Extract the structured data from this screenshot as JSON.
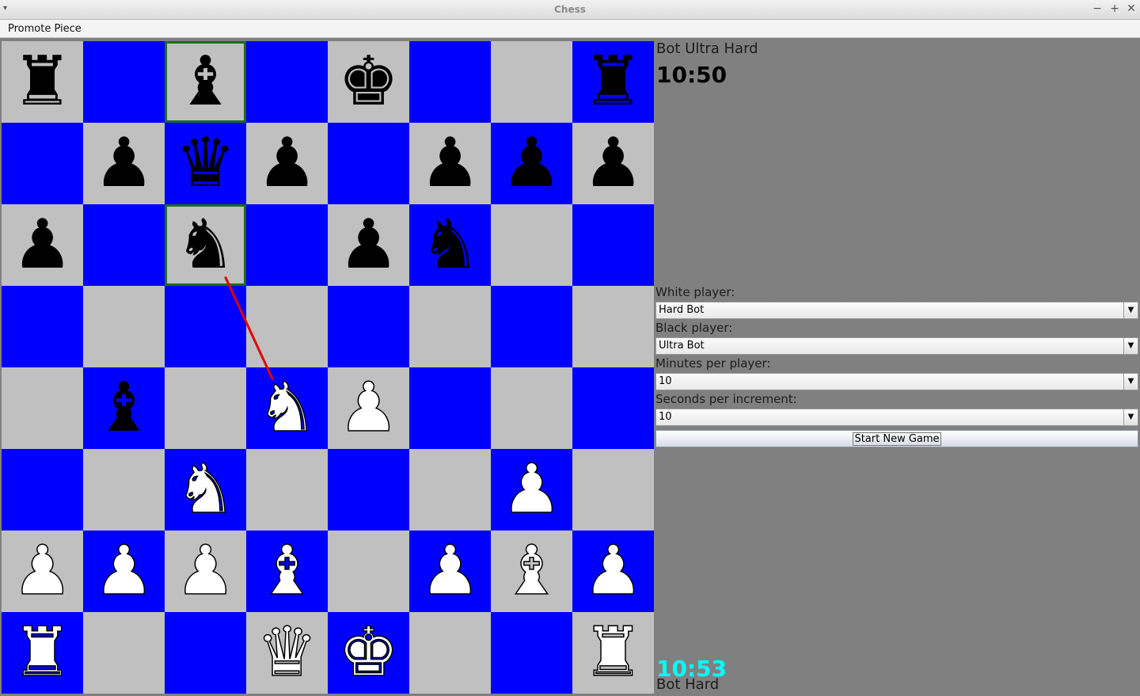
{
  "window": {
    "title": "Chess"
  },
  "menubar": {
    "items": [
      "Promote Piece"
    ]
  },
  "colors": {
    "light_square": "#c0c0c0",
    "dark_square": "#0000ff",
    "highlight": "#1f6b1f",
    "last_move_arrow": "#e00000",
    "white_clock": "#00ffff",
    "panel_bg": "#808080"
  },
  "board": {
    "ranks": [
      [
        "br",
        "",
        "bb",
        "",
        "bk",
        "",
        "",
        "br"
      ],
      [
        "",
        "bp",
        "bq",
        "bp",
        "",
        "bp",
        "bp",
        "bp"
      ],
      [
        "bp",
        "",
        "bn",
        "",
        "bp",
        "bn",
        "",
        ""
      ],
      [
        "",
        "",
        "",
        "",
        "",
        "",
        "",
        ""
      ],
      [
        "",
        "bb",
        "",
        "wn",
        "wp",
        "",
        "",
        ""
      ],
      [
        "",
        "",
        "wn",
        "",
        "",
        "",
        "wp",
        ""
      ],
      [
        "wp",
        "wp",
        "wp",
        "wb",
        "",
        "wp",
        "wb",
        "wp"
      ],
      [
        "wr",
        "",
        "",
        "wq",
        "wk",
        "",
        "",
        "wr"
      ]
    ],
    "highlighted": [
      "c8",
      "c6"
    ],
    "last_move": {
      "from": "c6",
      "to": "d4"
    }
  },
  "top_player": {
    "name": "Bot Ultra Hard",
    "clock": "10:50"
  },
  "bottom_player": {
    "name": "Bot Hard",
    "clock": "10:53"
  },
  "settings": {
    "white_label": "White player:",
    "white_value": "Hard Bot",
    "black_label": "Black player:",
    "black_value": "Ultra Bot",
    "minutes_label": "Minutes per player:",
    "minutes_value": "10",
    "increment_label": "Seconds per increment:",
    "increment_value": "10",
    "start_button": "Start New Game"
  }
}
